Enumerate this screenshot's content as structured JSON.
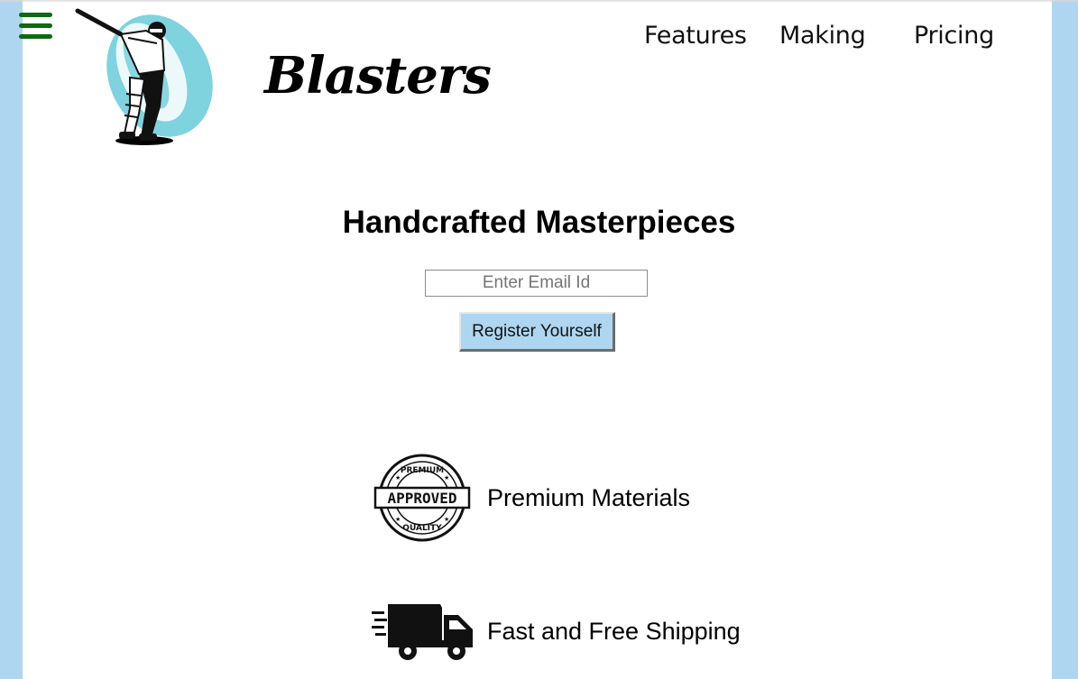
{
  "header": {
    "menu_icon": "hamburger-menu-icon",
    "logo_icon": "cricket-batsman-logo",
    "brand": "Blasters",
    "nav": [
      {
        "label": "Features"
      },
      {
        "label": "Making"
      },
      {
        "label": "Pricing"
      }
    ]
  },
  "hero": {
    "title": "Handcrafted Masterpieces",
    "email_placeholder": "Enter Email Id",
    "email_value": "",
    "register_label": "Register Yourself"
  },
  "features": [
    {
      "icon": "premium-approved-stamp-icon",
      "label": "Premium Materials"
    },
    {
      "icon": "delivery-truck-icon",
      "label": "Fast and Free Shipping"
    }
  ],
  "colors": {
    "background": "#aed6f0",
    "page": "#ffffff",
    "menu_icon": "#0b6a12",
    "button_bg": "#aed6f0",
    "logo_accent": "#7fd3df"
  }
}
